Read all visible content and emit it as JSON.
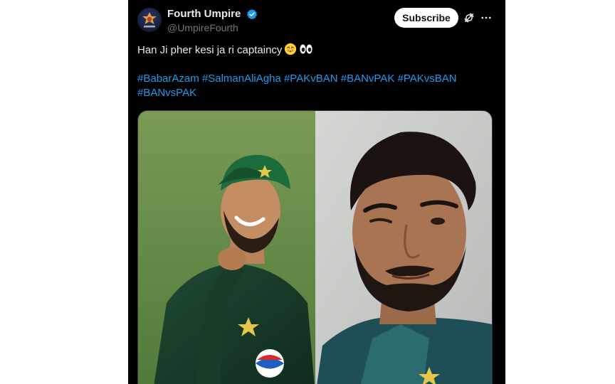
{
  "post": {
    "author": {
      "display_name": "Fourth Umpire",
      "handle": "@UmpireFourth",
      "verified": true,
      "avatar_icon": "umpire-logo-icon"
    },
    "subscribe_label": "Subscribe",
    "text": "Han Ji pher kesi ja ri captaincy",
    "emojis": [
      "grinning-face-emoji",
      "eyes-emoji"
    ],
    "hashtags": [
      "#BabarAzam",
      "#SalmanAliAgha",
      "#PAKvBAN",
      "#BANvPAK",
      "#PAKvsBAN",
      "#BANvsPAK"
    ],
    "media": {
      "left_image": "cricketer-smiling-looking-up",
      "right_image": "cricketer-smirking-at-camera"
    }
  },
  "colors": {
    "background": "#000000",
    "text": "#e7e9ea",
    "secondary_text": "#71767b",
    "hashtag": "#1d9bf0",
    "verified_badge": "#1d9bf0"
  }
}
